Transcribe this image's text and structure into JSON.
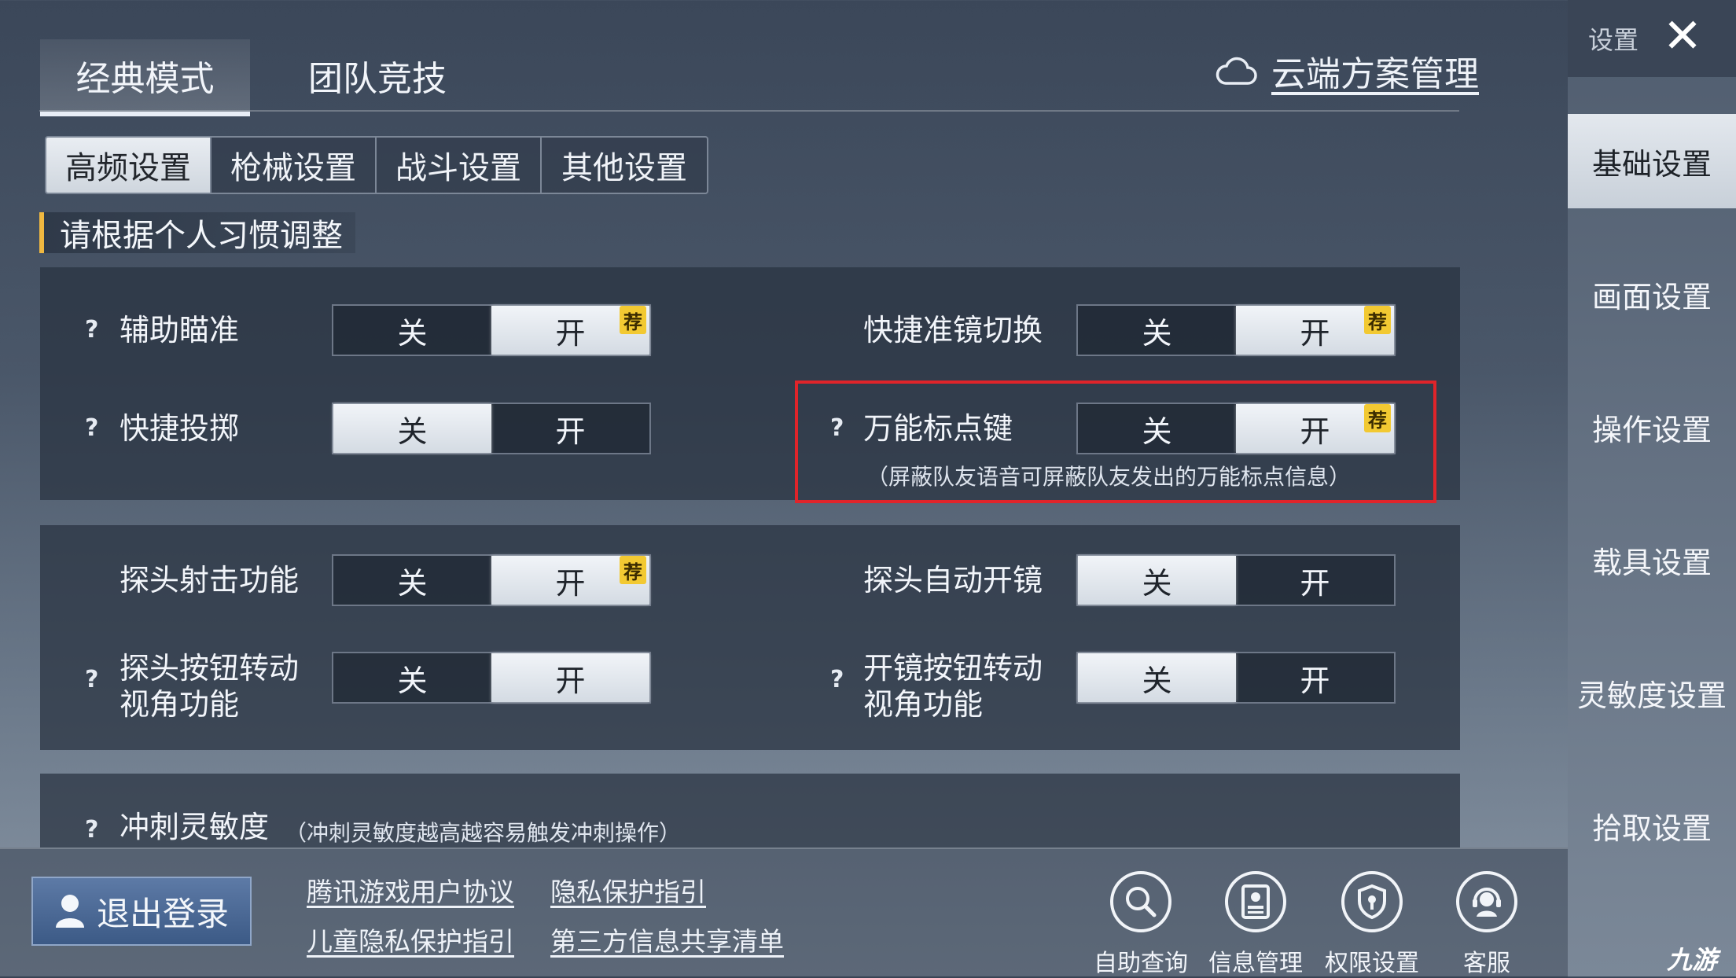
{
  "mode_tabs": [
    {
      "label": "经典模式",
      "active": true
    },
    {
      "label": "团队竞技",
      "active": false
    }
  ],
  "cloud_link": "云端方案管理",
  "sub_tabs": [
    {
      "label": "高频设置",
      "active": true
    },
    {
      "label": "枪械设置",
      "active": false
    },
    {
      "label": "战斗设置",
      "active": false
    },
    {
      "label": "其他设置",
      "active": false
    }
  ],
  "section_title": "请根据个人习惯调整",
  "toggle_text": {
    "off": "关",
    "on": "开",
    "recommend": "荐",
    "help": "?"
  },
  "settings": {
    "aim_assist": {
      "label": "辅助瞄准",
      "value": "开",
      "recommended": "开"
    },
    "scope_switch": {
      "label": "快捷准镜切换",
      "value": "开",
      "recommended": "开"
    },
    "quick_throw": {
      "label": "快捷投掷",
      "value": "关"
    },
    "universal_mark": {
      "label": "万能标点键",
      "value": "开",
      "recommended": "开",
      "note": "（屏蔽队友语音可屏蔽队友发出的万能标点信息）"
    },
    "peek_fire": {
      "label": "探头射击功能",
      "value": "开",
      "recommended": "开"
    },
    "peek_auto_scope": {
      "label": "探头自动开镜",
      "value": "关"
    },
    "peek_btn_rotate": {
      "label_line1": "探头按钮转动",
      "label_line2": "视角功能",
      "value": "开"
    },
    "scope_btn_rotate": {
      "label_line1": "开镜按钮转动",
      "label_line2": "视角功能",
      "value": "关"
    },
    "sprint_sensitivity": {
      "label": "冲刺灵敏度",
      "note": "（冲刺灵敏度越高越容易触发冲刺操作）"
    }
  },
  "sidebar": {
    "title": "设置",
    "items": [
      {
        "label": "基础设置",
        "active": true
      },
      {
        "label": "画面设置",
        "active": false
      },
      {
        "label": "操作设置",
        "active": false
      },
      {
        "label": "载具设置",
        "active": false
      },
      {
        "label": "灵敏度设置",
        "active": false
      },
      {
        "label": "拾取设置",
        "active": false
      }
    ]
  },
  "bottom": {
    "logout": "退出登录",
    "links": [
      "腾讯游戏用户协议",
      "隐私保护指引",
      "儿童隐私保护指引",
      "第三方信息共享清单"
    ],
    "icons": [
      {
        "label": "自助查询",
        "icon": "search-icon"
      },
      {
        "label": "信息管理",
        "icon": "id-card-icon"
      },
      {
        "label": "权限设置",
        "icon": "shield-icon"
      },
      {
        "label": "客服",
        "icon": "customer-service-icon"
      }
    ]
  },
  "watermark": "九游"
}
